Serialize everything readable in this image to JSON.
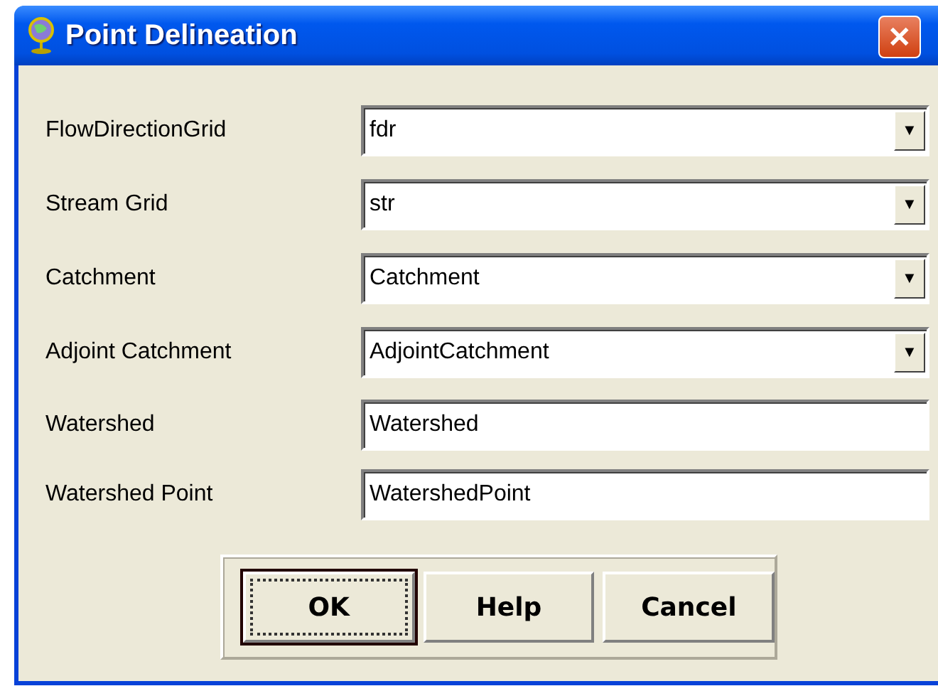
{
  "window": {
    "title": "Point Delineation",
    "close": "✕"
  },
  "fields": [
    {
      "label": "FlowDirectionGrid",
      "kind": "dropdown",
      "value": "fdr",
      "arrow": "▼"
    },
    {
      "label": "Stream Grid",
      "kind": "dropdown",
      "value": "str",
      "arrow": "▼"
    },
    {
      "label": "Catchment",
      "kind": "dropdown",
      "value": "Catchment",
      "arrow": "▼"
    },
    {
      "label": "Adjoint Catchment",
      "kind": "dropdown",
      "value": "AdjointCatchment",
      "arrow": "▼"
    },
    {
      "label": "Watershed",
      "kind": "text",
      "value": "Watershed"
    },
    {
      "label": "Watershed Point",
      "kind": "text",
      "value": "WatershedPoint"
    }
  ],
  "buttons": [
    {
      "label": "OK",
      "focused": true
    },
    {
      "label": "Help",
      "focused": false
    },
    {
      "label": "Cancel",
      "focused": false
    }
  ]
}
